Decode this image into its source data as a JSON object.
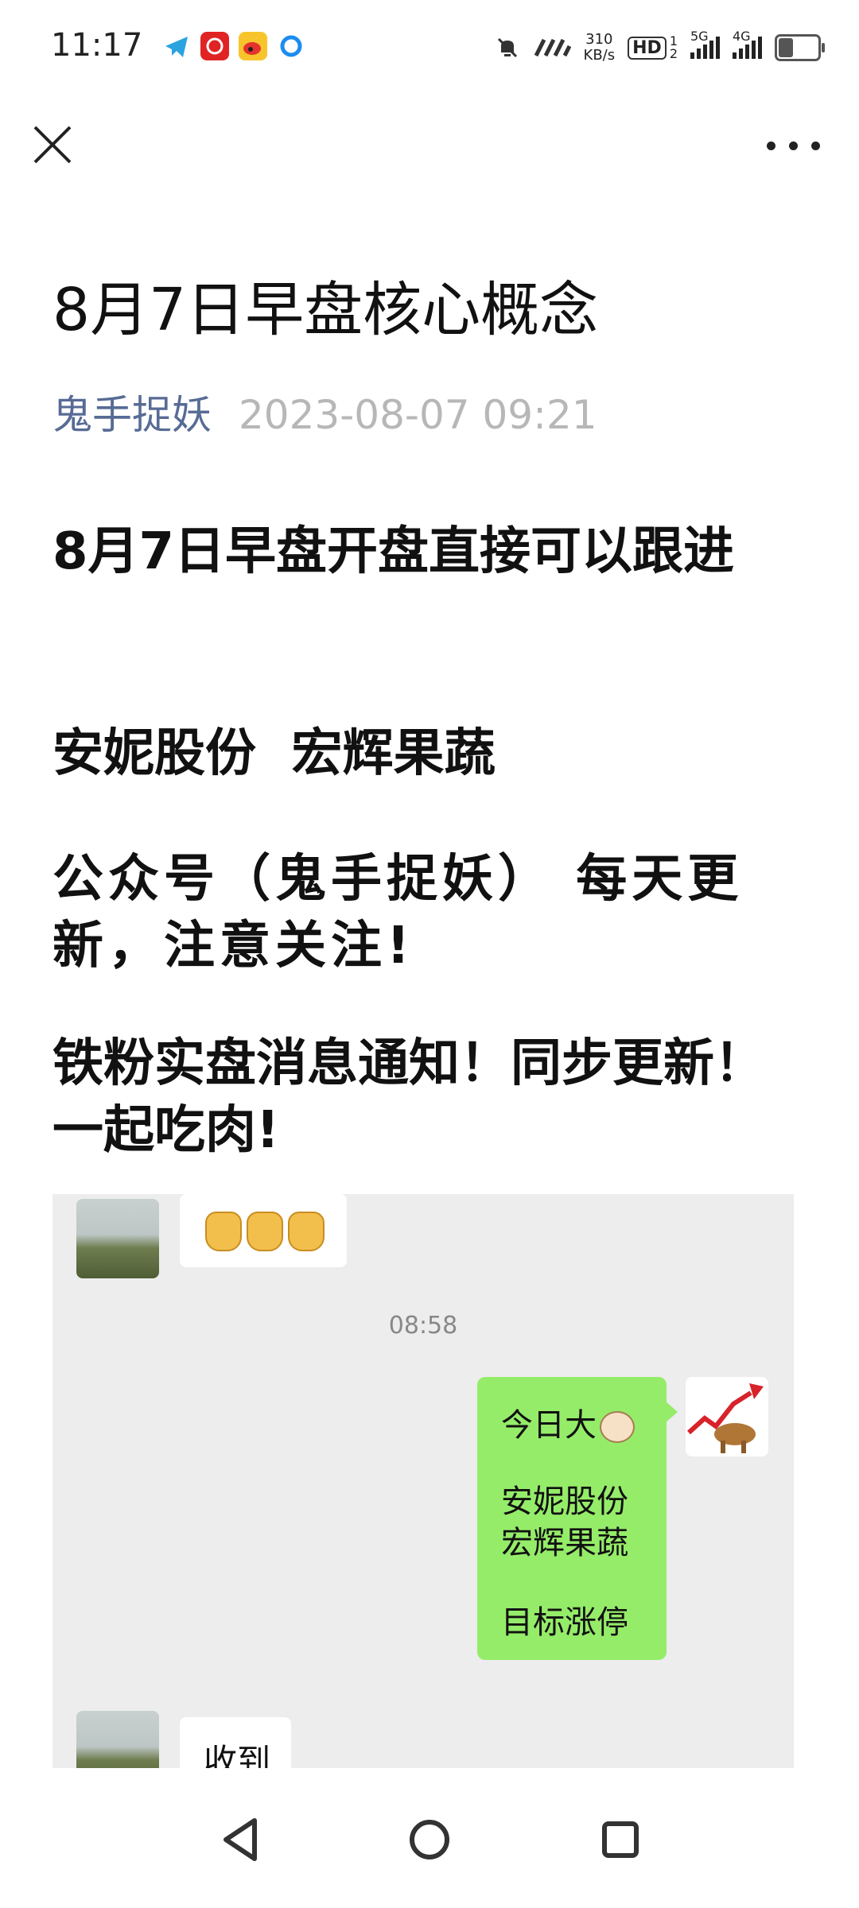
{
  "status_bar": {
    "time": "11:17",
    "network_speed": "310",
    "network_speed_unit": "KB/s",
    "hd_label": "HD",
    "sim1_label": "1",
    "sim2_label": "2",
    "signal1_label": "5G",
    "signal2_label": "4G",
    "notification_icons": [
      "telegram-icon",
      "app-red-icon",
      "weibo-icon",
      "browser-icon"
    ],
    "battery_level": 0.4
  },
  "nav": {
    "close_icon": "close-icon",
    "more_icon": "more-icon"
  },
  "article": {
    "title": "8月7日早盘核心概念",
    "author": "鬼手捉妖",
    "date": "2023-08-07 09:21",
    "paragraphs": [
      "8月7日早盘开盘直接可以跟进",
      "安妮股份  宏辉果蔬",
      "公众号（鬼手捉妖） 每天更新，注意关注!",
      "铁粉实盘消息通知！同步更新！一起吃肉!"
    ]
  },
  "chat": {
    "timestamp": "08:58",
    "sent_message": {
      "line1": "今日大",
      "line2": "安妮股份",
      "line3": "宏辉果蔬",
      "line4": "目标涨停"
    },
    "received_reply": "收到"
  },
  "colors": {
    "author": "#576b95",
    "date": "#b7b7b7",
    "sent_bubble": "#95ec69",
    "chat_bg": "#ededed"
  }
}
